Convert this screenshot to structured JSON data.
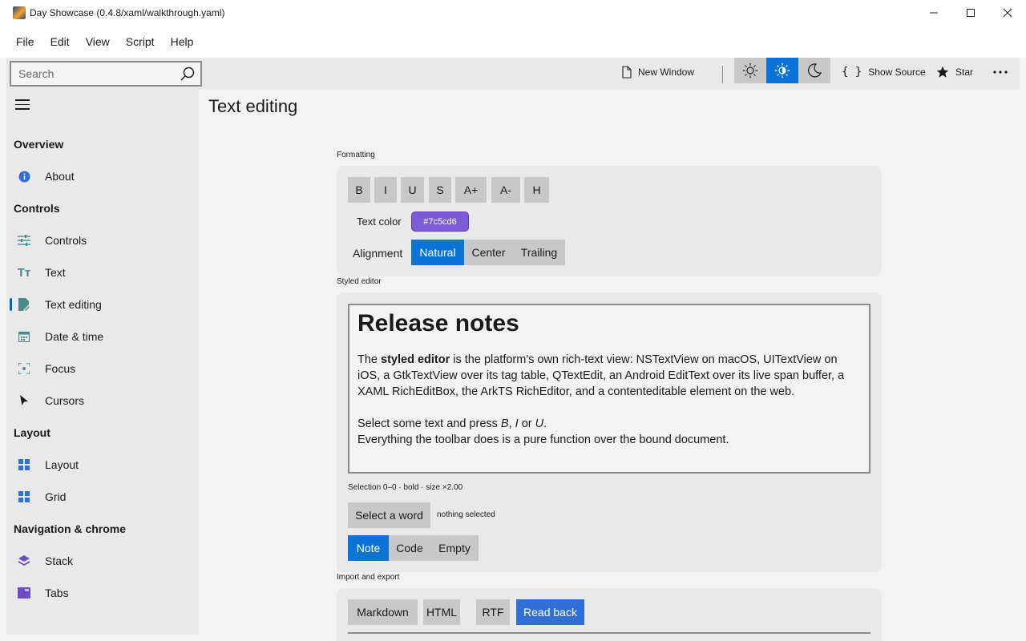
{
  "window": {
    "title": "Day Showcase (0.4.8/xaml/walkthrough.yaml)"
  },
  "menu": [
    "File",
    "Edit",
    "View",
    "Script",
    "Help"
  ],
  "toolbar": {
    "search_placeholder": "Search",
    "new_window": "New Window",
    "show_source": "Show Source",
    "star": "Star"
  },
  "sidebar": {
    "sections": [
      {
        "title": "Overview",
        "items": [
          {
            "label": "About",
            "icon": "info-icon"
          }
        ]
      },
      {
        "title": "Controls",
        "items": [
          {
            "label": "Controls",
            "icon": "sliders-icon"
          },
          {
            "label": "Text",
            "icon": "text-size-icon"
          },
          {
            "label": "Text editing",
            "icon": "edit-document-icon",
            "active": true
          },
          {
            "label": "Date & time",
            "icon": "calendar-icon"
          },
          {
            "label": "Focus",
            "icon": "focus-icon"
          },
          {
            "label": "Cursors",
            "icon": "cursor-icon"
          }
        ]
      },
      {
        "title": "Layout",
        "items": [
          {
            "label": "Layout",
            "icon": "layout-grid-icon"
          },
          {
            "label": "Grid",
            "icon": "grid-icon"
          }
        ]
      },
      {
        "title": "Navigation & chrome",
        "items": [
          {
            "label": "Stack",
            "icon": "stack-icon"
          },
          {
            "label": "Tabs",
            "icon": "tabs-icon"
          }
        ]
      }
    ]
  },
  "page": {
    "title": "Text editing"
  },
  "formatting": {
    "label": "Formatting",
    "buttons": [
      "B",
      "I",
      "U",
      "S",
      "A+",
      "A-",
      "H"
    ],
    "text_color_label": "Text color",
    "text_color_value": "#7c5cd6",
    "alignment_label": "Alignment",
    "alignment_options": [
      "Natural",
      "Center",
      "Trailing"
    ],
    "alignment_selected": "Natural"
  },
  "styled_editor": {
    "label": "Styled editor",
    "heading": "Release notes",
    "para1_prefix": "The ",
    "para1_bold": "styled editor",
    "para1_rest": " is the platform's own rich-text view: NSTextView on macOS, UITextView on iOS, a GtkTextView over its tag table, QTextEdit, an Android EditText over its live span buffer, a XAML RichEditBox, the ArkTS RichEditor, and a contenteditable element on the web.",
    "para2_prefix": "Select some text and press ",
    "para2_b": "B",
    "para2_sep1": ", ",
    "para2_i": "I",
    "para2_sep2": " or ",
    "para2_u": "U",
    "para2_end": ".",
    "para3": "Everything the toolbar does is a pure function over the bound document.",
    "selection_info": "Selection 0–0 · bold · size ×2.00",
    "select_word": "Select a word",
    "selection_status": "nothing selected",
    "preset_options": [
      "Note",
      "Code",
      "Empty"
    ],
    "preset_selected": "Note"
  },
  "import_export": {
    "label": "Import and export",
    "buttons": [
      "Markdown",
      "HTML",
      "RTF"
    ],
    "read_back": "Read back"
  },
  "colors": {
    "accent": "#0a74d6",
    "read_back": "#2f6fd6",
    "text_color_chip": "#7c5cd6"
  }
}
